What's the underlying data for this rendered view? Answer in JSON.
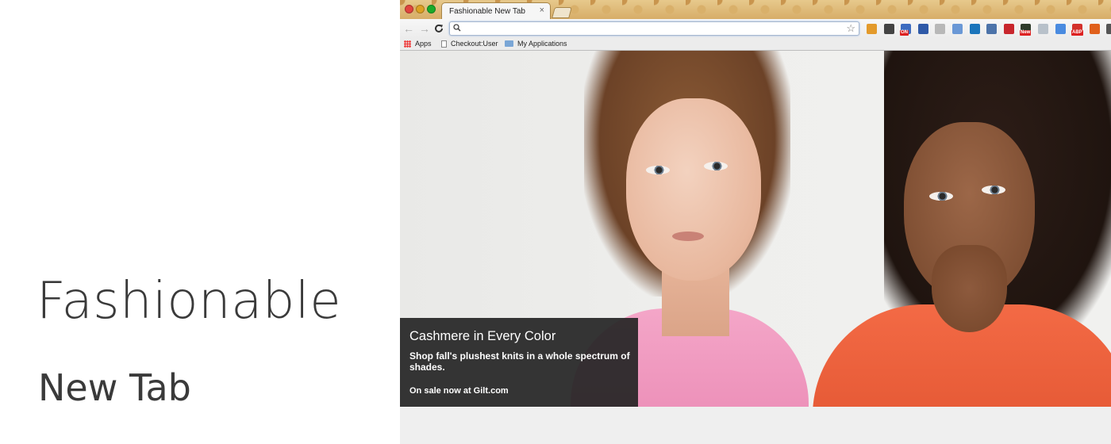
{
  "promo": {
    "title": "Fashionable",
    "subtitle": "New Tab"
  },
  "browser": {
    "tab": {
      "title": "Fashionable New Tab",
      "close": "×"
    },
    "toolbar": {
      "back": "←",
      "forward": "→",
      "reload": "C",
      "omnibox_value": "",
      "search_glyph": "⚲",
      "star": "☆"
    },
    "extensions": [
      {
        "name": "tag-extension-icon",
        "color": "#e39a2b"
      },
      {
        "name": "eyedropper-extension-icon",
        "color": "#444444"
      },
      {
        "name": "calendar-on-extension-icon",
        "color": "#3d6cc0",
        "badge": "ON"
      },
      {
        "name": "x-extension-icon",
        "color": "#2f5aa8"
      },
      {
        "name": "circle-extension-icon",
        "color": "#b8b8b8"
      },
      {
        "name": "blue-box-extension-icon",
        "color": "#6a98d6"
      },
      {
        "name": "c-extension-icon",
        "color": "#1b75bb"
      },
      {
        "name": "frame-extension-icon",
        "color": "#4c73a9"
      },
      {
        "name": "red-star-extension-icon",
        "color": "#c8262d"
      },
      {
        "name": "new-extension-icon",
        "color": "#2e3b2b",
        "badge": "New"
      },
      {
        "name": "gray-box-extension-icon",
        "color": "#b8c1ca"
      },
      {
        "name": "window-extension-icon",
        "color": "#4a8be0"
      },
      {
        "name": "abp-extension-icon",
        "color": "#d3312b",
        "badge": "ABP"
      },
      {
        "name": "fire-extension-icon",
        "color": "#e0601c"
      },
      {
        "name": "menu-icon",
        "color": "#555555"
      }
    ],
    "bookmarks": [
      {
        "label": "Apps",
        "icon": "apps-grid-icon"
      },
      {
        "label": "Checkout:User",
        "icon": "page-icon"
      },
      {
        "label": "My Applications",
        "icon": "folder-icon"
      }
    ]
  },
  "hero": {
    "caption_title": "Cashmere in Every Color",
    "caption_desc": "Shop fall's plushest knits in a whole spectrum of shades.",
    "caption_cta": "On sale now at Gilt.com"
  }
}
